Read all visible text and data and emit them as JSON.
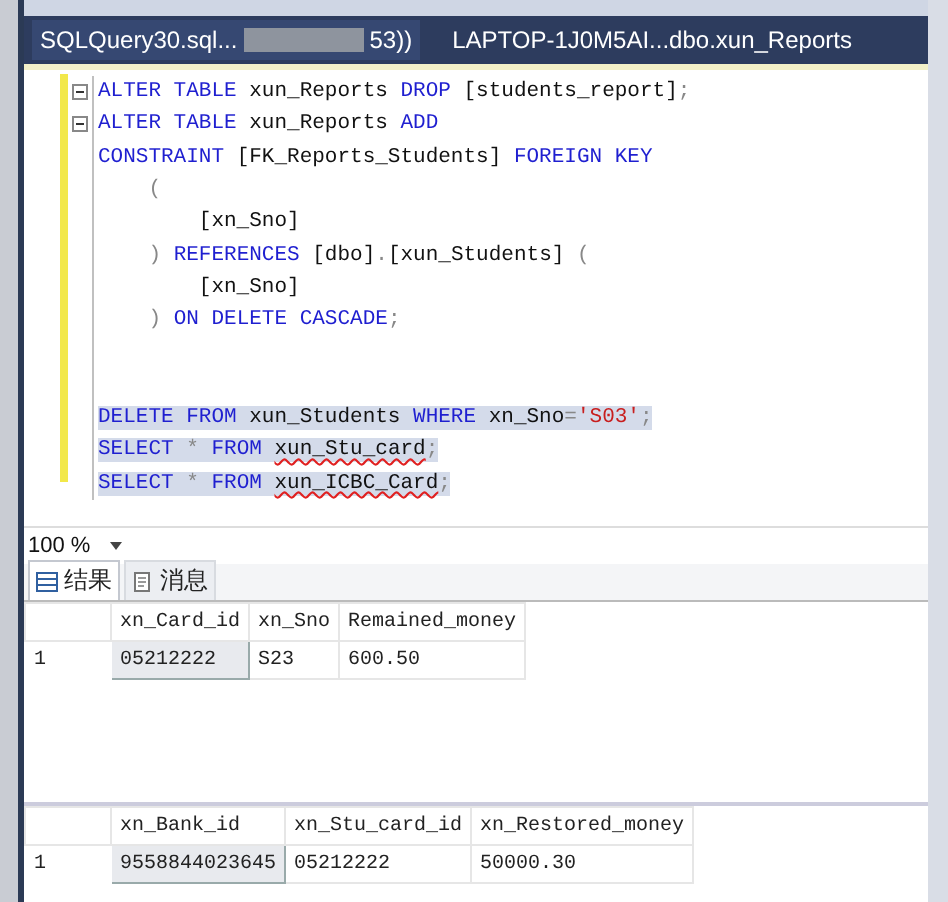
{
  "tabs": [
    {
      "label": "SQLQuery30.sql...",
      "tail": "53))",
      "redacted": true,
      "selected": true
    },
    {
      "label": "LAPTOP-1J0M5AI...dbo.xun_Reports",
      "redacted": false,
      "selected": false
    }
  ],
  "code_lines": [
    {
      "fold": true,
      "selected": false,
      "tokens": [
        {
          "kind": "keyword",
          "text": "ALTER TABLE"
        },
        {
          "kind": "plain",
          "text": " xun_Reports "
        },
        {
          "kind": "keyword",
          "text": "DROP"
        },
        {
          "kind": "plain",
          "text": " [students_report]"
        },
        {
          "kind": "punct",
          "text": ";"
        }
      ]
    },
    {
      "fold": true,
      "selected": false,
      "tokens": [
        {
          "kind": "keyword",
          "text": "ALTER TABLE"
        },
        {
          "kind": "plain",
          "text": " xun_Reports "
        },
        {
          "kind": "keyword",
          "text": "ADD"
        }
      ]
    },
    {
      "fold": false,
      "selected": false,
      "tokens": [
        {
          "kind": "keyword",
          "text": "CONSTRAINT"
        },
        {
          "kind": "plain",
          "text": " [FK_Reports_Students] "
        },
        {
          "kind": "keyword",
          "text": "FOREIGN KEY"
        }
      ]
    },
    {
      "fold": false,
      "selected": false,
      "tokens": [
        {
          "kind": "punct",
          "text": "    ("
        }
      ]
    },
    {
      "fold": false,
      "selected": false,
      "tokens": [
        {
          "kind": "plain",
          "text": "        [xn_Sno]"
        }
      ]
    },
    {
      "fold": false,
      "selected": false,
      "tokens": [
        {
          "kind": "punct",
          "text": "    ) "
        },
        {
          "kind": "keyword",
          "text": "REFERENCES"
        },
        {
          "kind": "plain",
          "text": " [dbo]"
        },
        {
          "kind": "punct",
          "text": "."
        },
        {
          "kind": "plain",
          "text": "[xun_Students] "
        },
        {
          "kind": "punct",
          "text": "("
        }
      ]
    },
    {
      "fold": false,
      "selected": false,
      "tokens": [
        {
          "kind": "plain",
          "text": "        [xn_Sno]"
        }
      ]
    },
    {
      "fold": false,
      "selected": false,
      "tokens": [
        {
          "kind": "punct",
          "text": "    ) "
        },
        {
          "kind": "keyword",
          "text": "ON DELETE CASCADE"
        },
        {
          "kind": "punct",
          "text": ";"
        }
      ]
    },
    {
      "fold": false
    },
    {
      "fold": false
    },
    {
      "fold": false,
      "selected": true,
      "tokens": [
        {
          "kind": "keyword",
          "text": "DELETE FROM"
        },
        {
          "kind": "plain",
          "text": " xun_Students "
        },
        {
          "kind": "keyword",
          "text": "WHERE"
        },
        {
          "kind": "plain",
          "text": " xn_Sno"
        },
        {
          "kind": "punct",
          "text": "="
        },
        {
          "kind": "string",
          "text": "'S03'"
        },
        {
          "kind": "punct",
          "text": ";"
        }
      ]
    },
    {
      "fold": false,
      "selected": true,
      "tokens": [
        {
          "kind": "keyword",
          "text": "SELECT"
        },
        {
          "kind": "punct",
          "text": " * "
        },
        {
          "kind": "keyword",
          "text": "FROM "
        },
        {
          "kind": "error",
          "text": "xun_Stu_card"
        },
        {
          "kind": "punct",
          "text": ";"
        }
      ]
    },
    {
      "fold": false,
      "selected": true,
      "tokens": [
        {
          "kind": "keyword",
          "text": "SELECT"
        },
        {
          "kind": "punct",
          "text": " * "
        },
        {
          "kind": "keyword",
          "text": "FROM "
        },
        {
          "kind": "error",
          "text": "xun_ICBC_Card"
        },
        {
          "kind": "punct",
          "text": ";"
        }
      ]
    }
  ],
  "zoom": {
    "value": "100 %"
  },
  "result_tabs": [
    {
      "label": "结果",
      "kind": "grid",
      "selected": true
    },
    {
      "label": "消息",
      "kind": "messages",
      "selected": false
    }
  ],
  "result_grids": [
    {
      "columns": [
        "xn_Card_id",
        "xn_Sno",
        "Remained_money"
      ],
      "rows": [
        {
          "number": "1",
          "cells": [
            {
              "text": "05212222",
              "selected": true
            },
            {
              "text": "S23",
              "selected": false
            },
            {
              "text": "600.50",
              "selected": false
            }
          ]
        }
      ]
    },
    {
      "columns": [
        "xn_Bank_id",
        "xn_Stu_card_id",
        "xn_Restored_money"
      ],
      "rows": [
        {
          "number": "1",
          "cells": [
            {
              "text": "9558844023645",
              "selected": true
            },
            {
              "text": "05212222",
              "selected": false
            },
            {
              "text": "50000.30",
              "selected": false
            }
          ]
        }
      ]
    }
  ]
}
